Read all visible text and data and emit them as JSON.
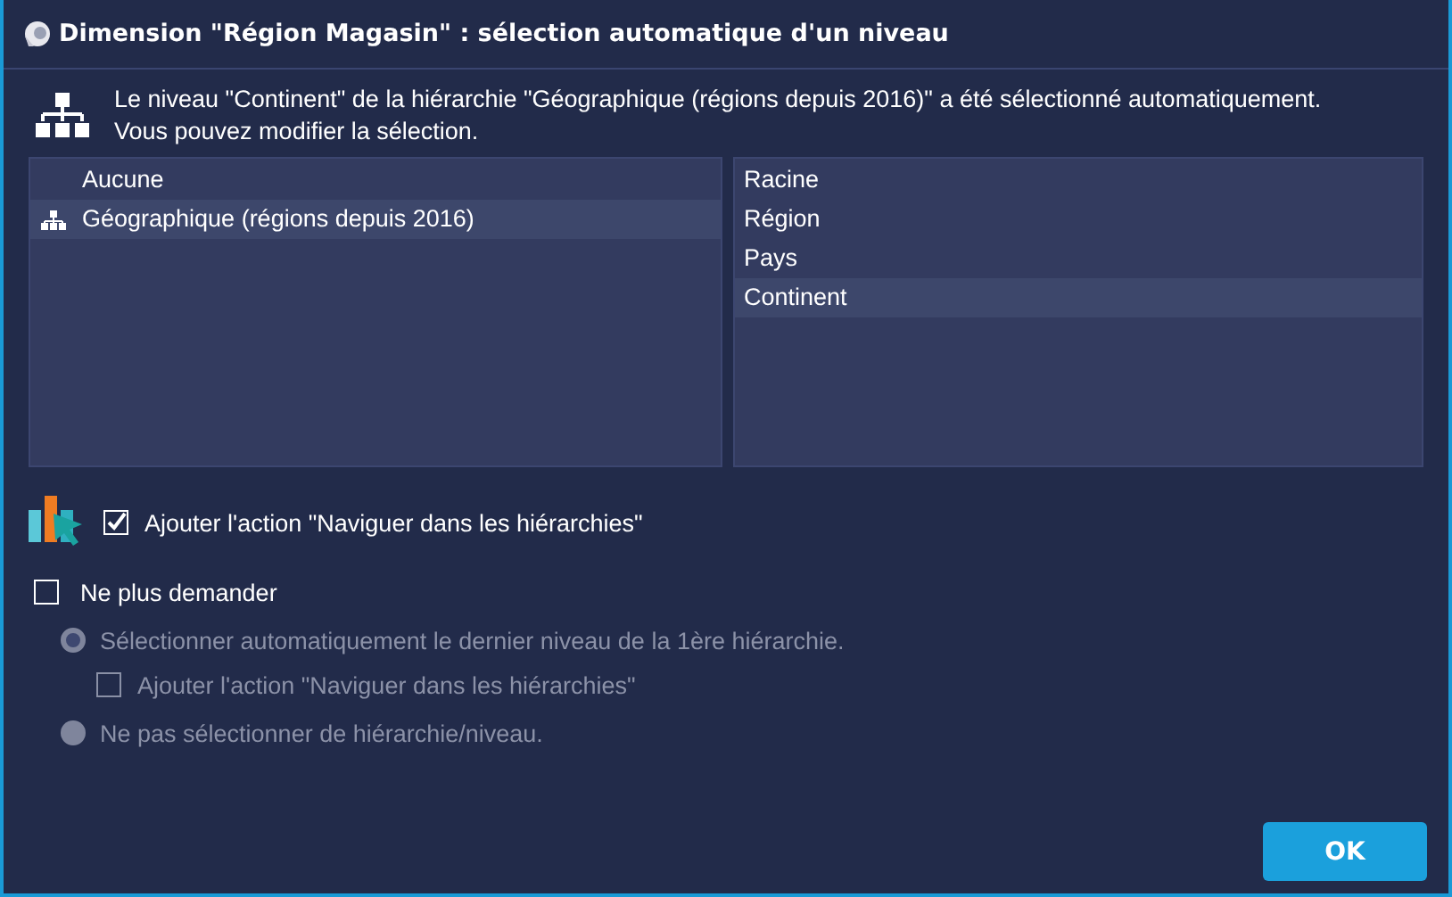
{
  "window": {
    "title": "Dimension \"Région Magasin\" : sélection automatique d'un niveau"
  },
  "message_lines": [
    "Le niveau \"Continent\" de la hiérarchie \"Géographique (régions depuis 2016)\" a été sélectionné automatiquement.",
    "Vous pouvez modifier la sélection."
  ],
  "hierarchies": [
    {
      "label": "Aucune",
      "kind": "none",
      "selected": false
    },
    {
      "label": "Géographique (régions depuis 2016)",
      "kind": "hierarchy",
      "selected": true
    }
  ],
  "levels": [
    {
      "label": "Racine",
      "selected": false
    },
    {
      "label": "Région",
      "selected": false
    },
    {
      "label": "Pays",
      "selected": false
    },
    {
      "label": "Continent",
      "selected": true
    }
  ],
  "add_action": {
    "label": "Ajouter l'action \"Naviguer dans les hiérarchies\"",
    "checked": true
  },
  "dont_ask": {
    "label": "Ne plus demander",
    "checked": false
  },
  "options": [
    {
      "kind": "radio",
      "label": "Sélectionner automatiquement le dernier niveau de la 1ère hiérarchie.",
      "selected": true,
      "disabled": true
    },
    {
      "kind": "checkbox",
      "label": "Ajouter l'action \"Naviguer dans les hiérarchies\"",
      "checked": false,
      "disabled": true
    },
    {
      "kind": "radio",
      "label": "Ne pas sélectionner de hiérarchie/niveau.",
      "selected": false,
      "disabled": true
    }
  ],
  "buttons": [
    "OK"
  ]
}
